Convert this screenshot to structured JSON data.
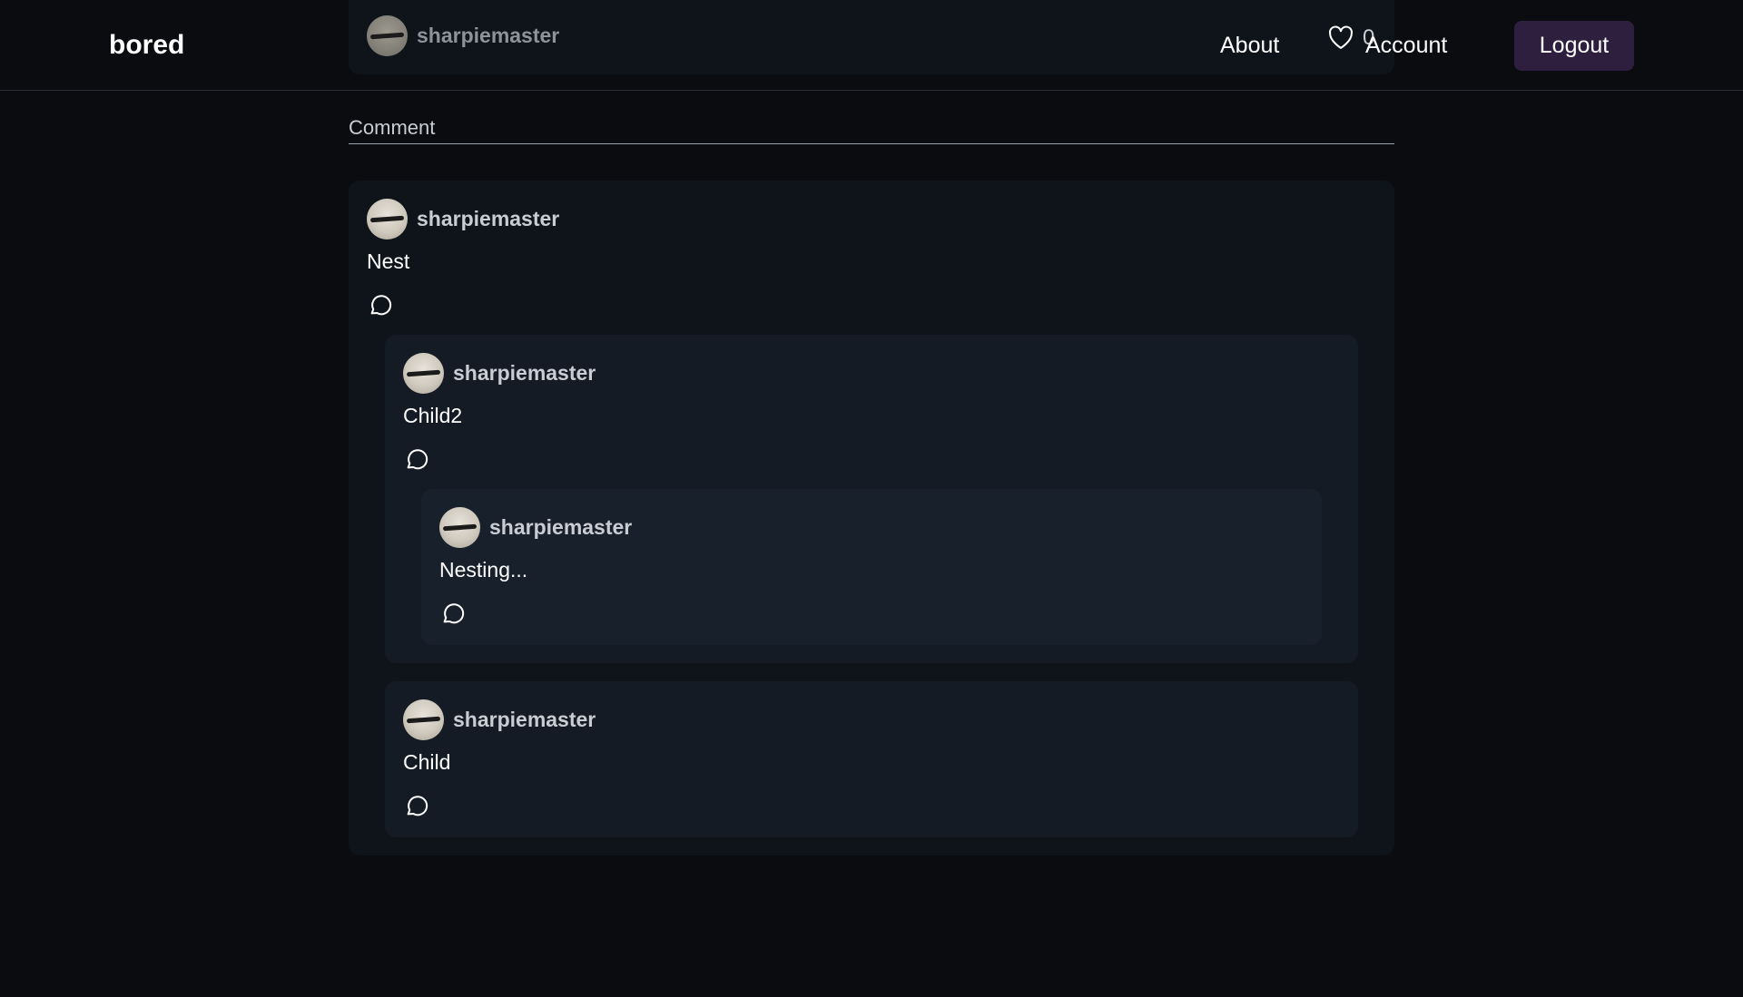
{
  "header": {
    "brand": "bored",
    "nav_about": "About",
    "like_count": "0",
    "nav_account": "Account",
    "logout_label": "Logout"
  },
  "previous_post": {
    "username": "sharpiemaster"
  },
  "comment_section": {
    "label": "Comment"
  },
  "comments": [
    {
      "username": "sharpiemaster",
      "text": "Nest",
      "children": [
        {
          "username": "sharpiemaster",
          "text": "Child2",
          "children": [
            {
              "username": "sharpiemaster",
              "text": "Nesting...",
              "children": []
            }
          ]
        },
        {
          "username": "sharpiemaster",
          "text": "Child",
          "children": []
        }
      ]
    }
  ],
  "colors": {
    "background": "#0a0c10",
    "card_level_0": "#0f141a",
    "card_level_1": "#141b24",
    "card_level_2": "#18202c",
    "logout_button": "#2d1f3d"
  },
  "icons": {
    "reply": "speech-bubble-icon",
    "like": "heart-icon",
    "avatar": "avatar-image"
  }
}
